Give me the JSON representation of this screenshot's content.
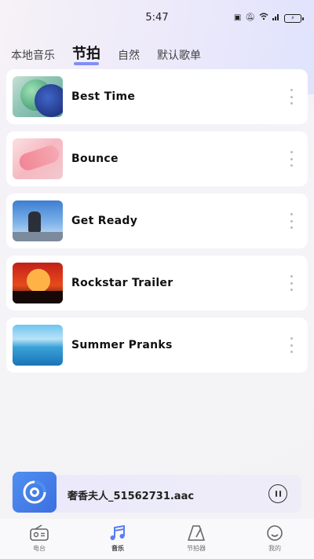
{
  "status_bar": {
    "time": "5:47",
    "icons": [
      "sim-icon",
      "mute-icon",
      "wifi-icon",
      "signal-icon",
      "battery-icon"
    ]
  },
  "tabs": [
    {
      "label": "本地音乐",
      "active": false
    },
    {
      "label": "节拍",
      "active": true
    },
    {
      "label": "自然",
      "active": false
    },
    {
      "label": "默认歌单",
      "active": false
    }
  ],
  "tracks": [
    {
      "title": "Best Time"
    },
    {
      "title": "Bounce"
    },
    {
      "title": "Get Ready"
    },
    {
      "title": "Rockstar Trailer"
    },
    {
      "title": "Summer Pranks"
    }
  ],
  "player": {
    "title": "奢香夫人_51562731.aac",
    "state": "playing"
  },
  "bottom_nav": [
    {
      "label": "电台",
      "icon": "radio-icon",
      "active": false
    },
    {
      "label": "音乐",
      "icon": "music-note-icon",
      "active": true
    },
    {
      "label": "节拍器",
      "icon": "metronome-icon",
      "active": false
    },
    {
      "label": "我的",
      "icon": "profile-icon",
      "active": false
    }
  ],
  "colors": {
    "accent": "#7f8ff7",
    "active_nav": "#5b7df0",
    "player_cover": "#4f8ff0"
  }
}
